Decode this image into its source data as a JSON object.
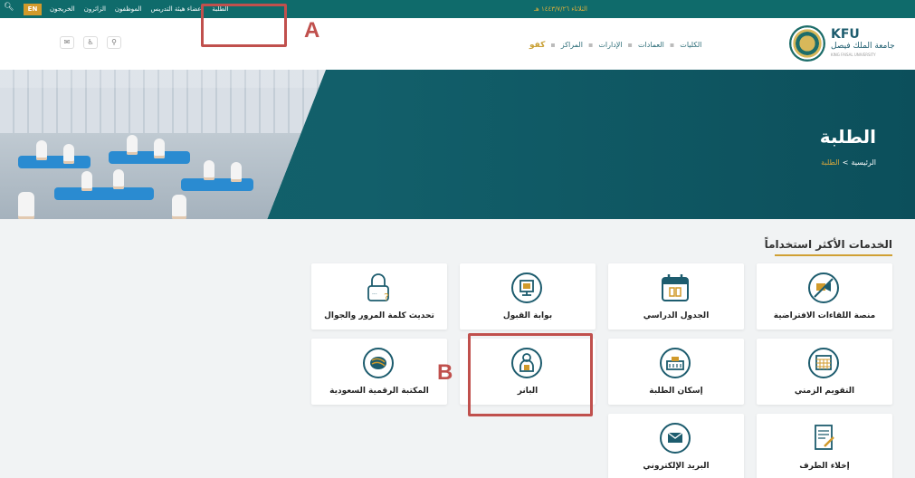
{
  "topbar": {
    "lang": "EN",
    "links": [
      "الخريجون",
      "الزائرون",
      "الموظفون",
      "أعضاء هيئة التدريس",
      "الطلبة"
    ],
    "date": "الثلاثاء ١٤٤٣/٧/٢٦ هـ"
  },
  "header": {
    "nav": [
      "كفو",
      "المراكز",
      "الإدارات",
      "العمادات",
      "الكليات"
    ],
    "logo": {
      "kfu": "KFU",
      "arabic": "جامعة الملك فيصل",
      "english": "KING FAISAL UNIVERSITY"
    }
  },
  "hero": {
    "title": "الطلبة",
    "breadcrumb_home": "الرئيسية",
    "breadcrumb_sep": ">",
    "breadcrumb_current": "الطلبة"
  },
  "services": {
    "title": "الخدمات الأكثر استخداماً",
    "items": [
      {
        "label": "منصة اللقاءات الافتراضية",
        "icon": "virtual-meeting-icon"
      },
      {
        "label": "الجدول الدراسي",
        "icon": "calendar-schedule-icon"
      },
      {
        "label": "بوابة القبول",
        "icon": "admission-portal-icon"
      },
      {
        "label": "تحديث كلمة المرور والجوال",
        "icon": "password-lock-icon"
      },
      {
        "label": "التقويم الزمني",
        "icon": "calendar-grid-icon"
      },
      {
        "label": "إسكان الطلبة",
        "icon": "housing-icon"
      },
      {
        "label": "البانر",
        "icon": "banner-user-icon"
      },
      {
        "label": "المكتبة الرقمية السعودية",
        "icon": "digital-library-icon"
      },
      {
        "label": "إخلاء الطرف",
        "icon": "clearance-document-icon"
      },
      {
        "label": "البريد الإلكتروني",
        "icon": "email-envelope-icon"
      }
    ]
  },
  "annotations": {
    "a": "A",
    "b": "B"
  },
  "colors": {
    "teal": "#0f6b6b",
    "gold": "#d0a033",
    "annotation": "#c0504d"
  }
}
